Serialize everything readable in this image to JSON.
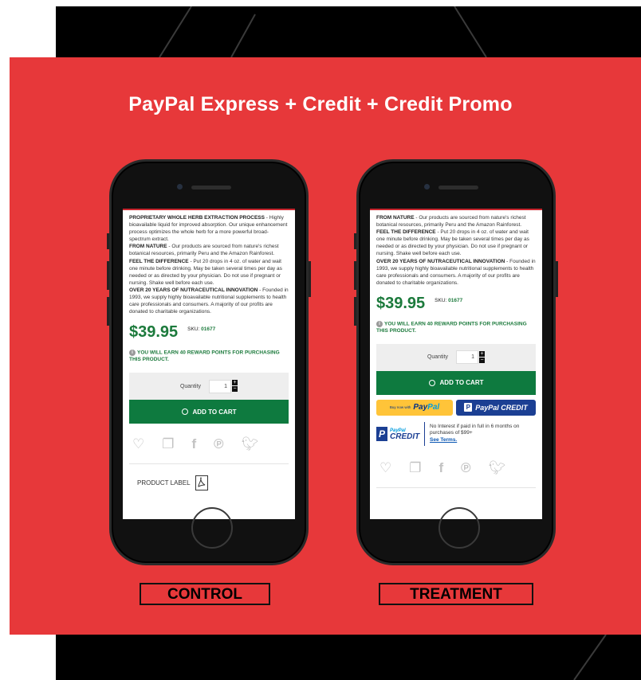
{
  "headline": "PayPal Express + Credit + Credit Promo",
  "captions": {
    "control": "CONTROL",
    "treatment": "TREATMENT"
  },
  "colors": {
    "panel": "#e7383a",
    "price_green": "#1c7a3c",
    "cart_green": "#0e7a3f",
    "paypal_yellow": "#ffc439",
    "paypal_blue": "#1b3f93"
  },
  "control": {
    "sections": [
      {
        "title": "PROPRIETARY WHOLE HERB EXTRACTION PROCESS",
        "text": " - Highly bioavailable liquid for improved absorption. Our unique enhancement process optimizes the whole herb for a more powerful broad-spectrum extract."
      },
      {
        "title": "FROM NATURE",
        "text": " - Our products are sourced from nature's richest botanical resources, primarily Peru and the Amazon Rainforest."
      },
      {
        "title": "FEEL THE DIFFERENCE",
        "text": " - Put 20 drops in 4 oz. of water and wait one minute before drinking. May be taken several times per day as needed or as directed by your physician. Do not use if pregnant or nursing. Shake well before each use."
      },
      {
        "title": "OVER 20 YEARS OF NUTRACEUTICAL INNOVATION",
        "text": " - Founded in 1993, we supply highly bioavailable nutritional supplements to health care professionals and consumers. A majority of our profits are donated to charitable organizations."
      }
    ],
    "price": "$39.95",
    "sku_label": "SKU:",
    "sku_value": "01677",
    "reward": "YOU WILL EARN 40 REWARD POINTS FOR PURCHASING THIS PRODUCT.",
    "quantity_label": "Quantity",
    "quantity_value": "1",
    "add_to_cart": "ADD TO CART",
    "product_label": "PRODUCT LABEL",
    "share_icons": [
      "heart-icon",
      "copy-icon",
      "facebook-icon",
      "pinterest-icon",
      "twitter-icon"
    ]
  },
  "treatment": {
    "sections": [
      {
        "title": "FROM NATURE",
        "text": " - Our products are sourced from nature's richest botanical resources, primarily Peru and the Amazon Rainforest."
      },
      {
        "title": "FEEL THE DIFFERENCE",
        "text": " - Put 20 drops in 4 oz. of water and wait one minute before drinking. May be taken several times per day as needed or as directed by your physician. Do not use if pregnant or nursing. Shake well before each use."
      },
      {
        "title": "OVER 20 YEARS OF NUTRACEUTICAL INNOVATION",
        "text": " - Founded in 1993, we supply highly bioavailable nutritional supplements to health care professionals and consumers. A majority of our profits are donated to charitable organizations."
      }
    ],
    "price": "$39.95",
    "sku_label": "SKU:",
    "sku_value": "01677",
    "reward": "YOU WILL EARN 40 REWARD POINTS FOR PURCHASING THIS PRODUCT.",
    "quantity_label": "Quantity",
    "quantity_value": "1",
    "add_to_cart": "ADD TO CART",
    "paypal_buynow_prefix": "Buy now with",
    "paypal_buynow_brand_a": "Pay",
    "paypal_buynow_brand_b": "Pal",
    "paypal_credit_button": "PayPal CREDIT",
    "promo_logo_top": "PayPal",
    "promo_logo_bottom": "CREDIT",
    "promo_text": "No Interest if paid in full in 6 months on purchases of $99+",
    "promo_terms": "See Terms."
  }
}
